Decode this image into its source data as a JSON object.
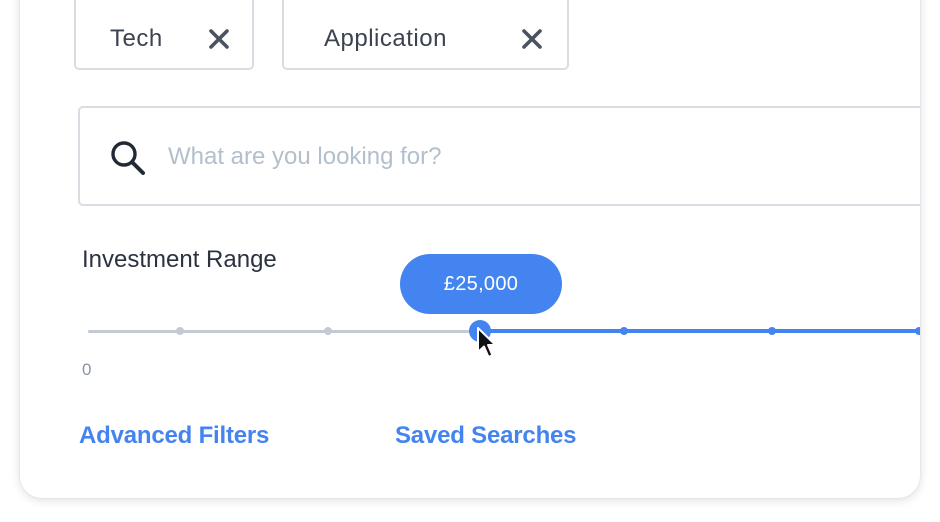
{
  "filter_tags": [
    {
      "label": "Tech",
      "remove_icon": "close-icon"
    },
    {
      "label": "Application",
      "remove_icon": "close-icon"
    }
  ],
  "search": {
    "icon": "search-icon",
    "placeholder": "What are you looking for?",
    "value": ""
  },
  "investment_range": {
    "label": "Investment Range",
    "current_value_label": "£25,000",
    "min_label": "0",
    "position_fraction": 0.47
  },
  "links": {
    "advanced_filters": "Advanced Filters",
    "saved_searches": "Saved Searches"
  },
  "colors": {
    "accent": "#4484f0",
    "track_inactive": "#c2cad3",
    "border": "#d8dde3",
    "text": "#2b3340",
    "placeholder": "#b3bfcc"
  }
}
